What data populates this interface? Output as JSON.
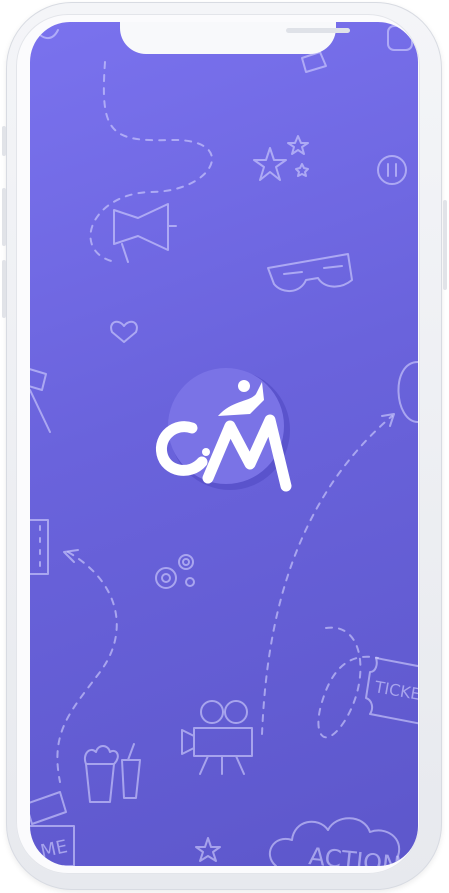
{
  "app": {
    "logo_text": "CM",
    "logo_accent_color": "#4b45b8",
    "logo_color": "#ffffff"
  },
  "screen": {
    "background_color_top": "#7a72ee",
    "background_color_bottom": "#5d57cb",
    "doodle_labels": {
      "ticket": "TICKE",
      "action": "ACTION",
      "ame": "AME"
    }
  },
  "device": {
    "frame_color": "#eef0f4",
    "notch_color": "#f8f9fb"
  }
}
